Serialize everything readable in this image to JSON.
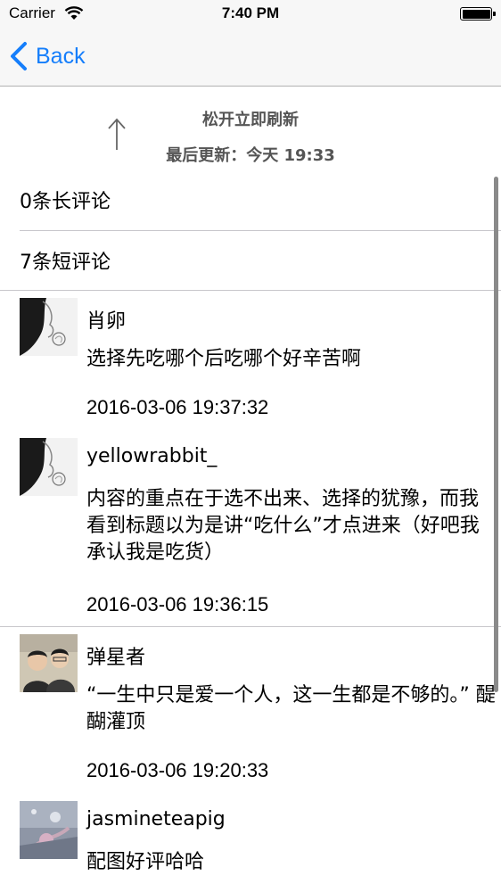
{
  "status_bar": {
    "carrier": "Carrier",
    "time": "7:40 PM"
  },
  "nav": {
    "back_label": "Back"
  },
  "refresh": {
    "status": "松开立即刷新",
    "updated": "最后更新：今天 19:33"
  },
  "sections": {
    "long_reviews": "0条长评论",
    "short_reviews": "7条短评论"
  },
  "comments": [
    {
      "author": "肖卵",
      "text": "选择先吃哪个后吃哪个好辛苦啊",
      "time": "2016-03-06 19:37:32"
    },
    {
      "author": "yellowrabbit_",
      "text": "内容的重点在于选不出来、选择的犹豫，而我看到标题以为是讲“吃什么”才点进来（好吧我承认我是吃货）",
      "time": "2016-03-06 19:36:15"
    },
    {
      "author": "弹星者",
      "text": "“一生中只是爱一个人，这一生都是不够的。” 醍醐灌顶",
      "time": "2016-03-06 19:20:33"
    },
    {
      "author": "jasmineteapig",
      "text": "配图好评哈哈",
      "time": ""
    }
  ]
}
